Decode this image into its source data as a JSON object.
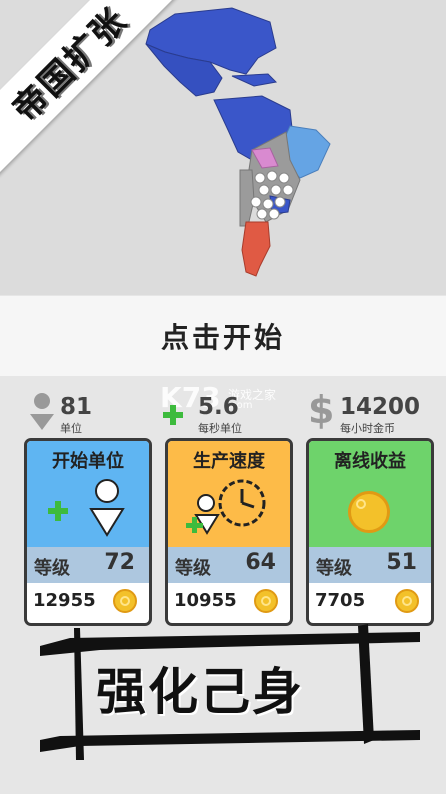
{
  "banner": {
    "title": "帝国扩张"
  },
  "start": {
    "label": "点击开始"
  },
  "stats": [
    {
      "value": "81",
      "label": "单位",
      "icon": "person-icon"
    },
    {
      "value": "5.6",
      "label": "每秒单位",
      "icon": "plus-icon"
    },
    {
      "value": "14200",
      "label": "每小时金币",
      "icon": "dollar-icon"
    }
  ],
  "cards": [
    {
      "title": "开始单位",
      "level_label": "等级",
      "level": "72",
      "cost": "12955",
      "color": "#5fb5f2",
      "icon": "add-unit-icon"
    },
    {
      "title": "生产速度",
      "level_label": "等级",
      "level": "64",
      "cost": "10955",
      "color": "#fdbb48",
      "icon": "speed-clock-icon"
    },
    {
      "title": "离线收益",
      "level_label": "等级",
      "level": "51",
      "cost": "7705",
      "color": "#6ed36b",
      "icon": "gold-coin-icon"
    }
  ],
  "promo": {
    "text": "强化己身"
  },
  "watermark": {
    "logo": "K73",
    "site": "游戏之家",
    "url": ".com"
  },
  "colors": {
    "blue_territory": "#3a56c9",
    "light_blue": "#65a4e4",
    "red_territory": "#e05a44",
    "pink_territory": "#d98ad0",
    "gray_territory": "#9b9b9b"
  }
}
